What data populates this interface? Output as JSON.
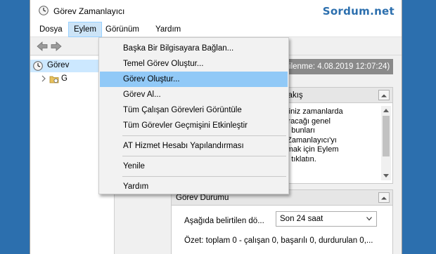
{
  "window": {
    "title": "Görev Zamanlayıcı",
    "watermark": "Sordum.net"
  },
  "menubar": {
    "items": [
      {
        "label": "Dosya"
      },
      {
        "label": "Eylem"
      },
      {
        "label": "Görünüm"
      },
      {
        "label": "Yardım"
      }
    ]
  },
  "dropdown": {
    "items": [
      {
        "label": "Başka Bir Bilgisayara Bağlan..."
      },
      {
        "label": "Temel Görev Oluştur..."
      },
      {
        "label": "Görev Oluştur..."
      },
      {
        "label": "Görev Al..."
      },
      {
        "label": "Tüm Çalışan Görevleri Görüntüle"
      },
      {
        "label": "Tüm Görevler Geçmişini Etkinleştir"
      },
      {
        "label": "AT Hizmet Hesabı Yapılandırması"
      },
      {
        "label": "Yenile"
      },
      {
        "label": "Yardım"
      }
    ],
    "highlighted_index": 2
  },
  "tree": {
    "root_label": "Görev",
    "child_label": "G"
  },
  "content": {
    "header_visible": "(Son yenilenme: 4.08.2019 12:07:24)",
    "overview_title": "Genel Bakış",
    "overview_text": "n belirttiğiniz zamanlarda\nak çalıştıracağı genel\nurmak ve bunları\nn Görev Zamanlayıcı'yı\niz. Başlamak için Eylem\nir komutu tıklatın.",
    "status_title": "Görev Durumu",
    "status_label": "Aşağıda belirtilen dö...",
    "status_select_value": "Son 24 saat",
    "summary": "Özet: toplam 0 - çalışan 0, başarılı 0, durdurulan 0,..."
  },
  "colors": {
    "desktop": "#2c6fae",
    "menu_highlight": "#91c9f7",
    "active_menu": "#cce4f7",
    "header_gray": "#8a8a8a"
  }
}
